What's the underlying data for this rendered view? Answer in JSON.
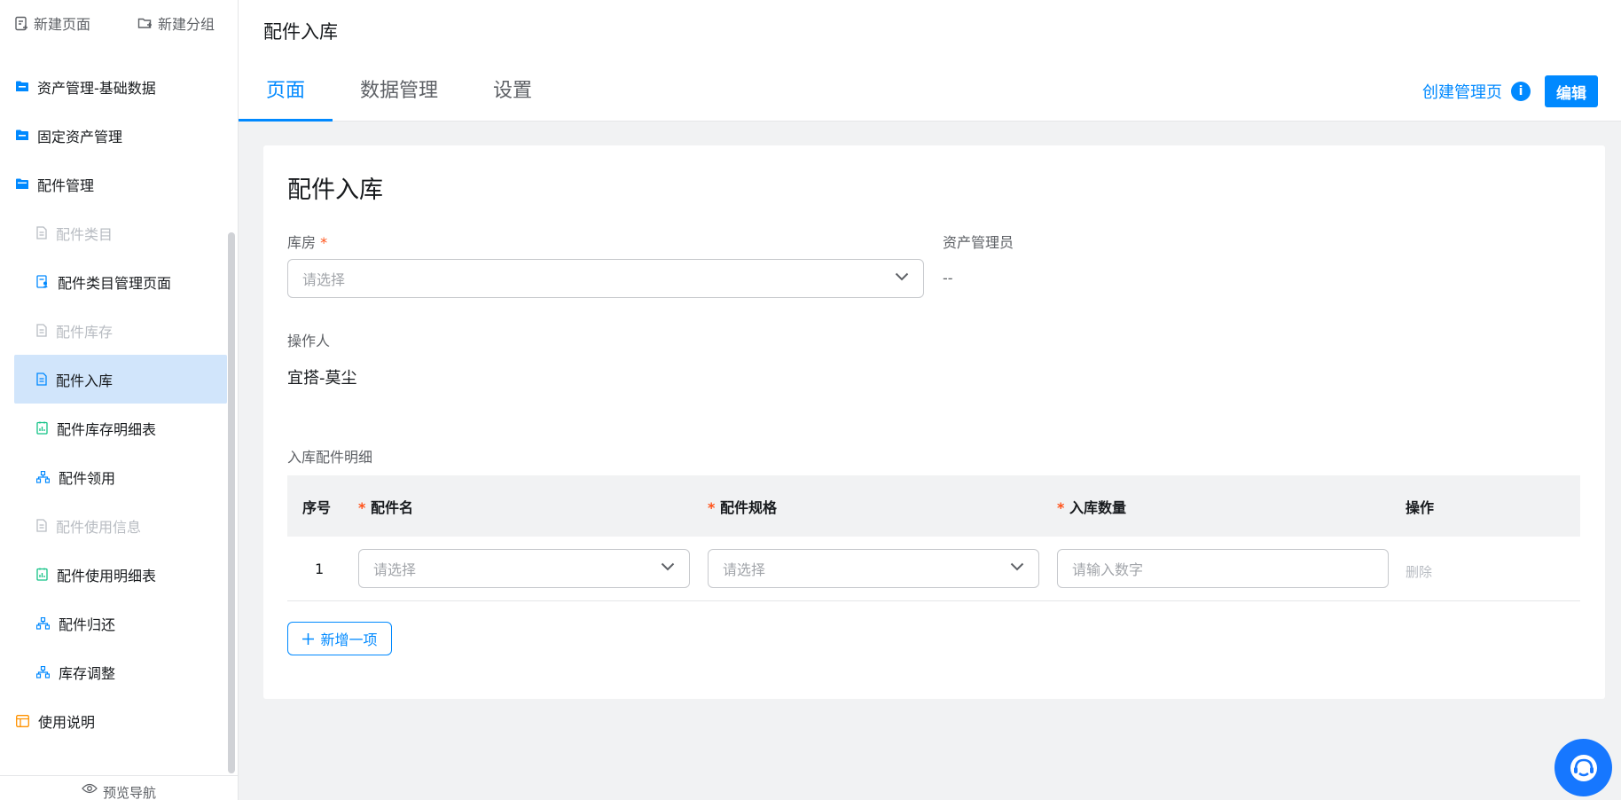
{
  "sidebar": {
    "new_page": "新建页面",
    "new_group": "新建分组",
    "items": [
      {
        "label": "资产管理-基础数据"
      },
      {
        "label": "固定资产管理"
      },
      {
        "label": "配件管理"
      },
      {
        "label": "配件类目"
      },
      {
        "label": "配件类目管理页面"
      },
      {
        "label": "配件库存"
      },
      {
        "label": "配件入库"
      },
      {
        "label": "配件库存明细表"
      },
      {
        "label": "配件领用"
      },
      {
        "label": "配件使用信息"
      },
      {
        "label": "配件使用明细表"
      },
      {
        "label": "配件归还"
      },
      {
        "label": "库存调整"
      },
      {
        "label": "使用说明"
      }
    ],
    "preview_nav": "预览导航"
  },
  "header": {
    "title": "配件入库",
    "tabs": [
      {
        "label": "页面"
      },
      {
        "label": "数据管理"
      },
      {
        "label": "设置"
      }
    ],
    "create_admin_page": "创建管理页",
    "info_icon_glyph": "i",
    "edit": "编辑"
  },
  "form": {
    "title": "配件入库",
    "warehouse_label": "库房",
    "required_mark": "*",
    "warehouse_placeholder": "请选择",
    "admin_label": "资产管理员",
    "admin_value": "--",
    "operator_label": "操作人",
    "operator_value": "宜搭-莫尘",
    "detail_label": "入库配件明细"
  },
  "table": {
    "headers": {
      "no": "序号",
      "name": "配件名",
      "spec": "配件规格",
      "qty": "入库数量",
      "op": "操作"
    },
    "rows": [
      {
        "no": "1",
        "name_placeholder": "请选择",
        "spec_placeholder": "请选择",
        "qty_placeholder": "请输入数字",
        "delete": "删除"
      }
    ],
    "add_item": "新增一项"
  },
  "colors": {
    "accent": "#0089ff",
    "required": "#ff5219",
    "active_nav_bg": "#d1e5fb"
  }
}
